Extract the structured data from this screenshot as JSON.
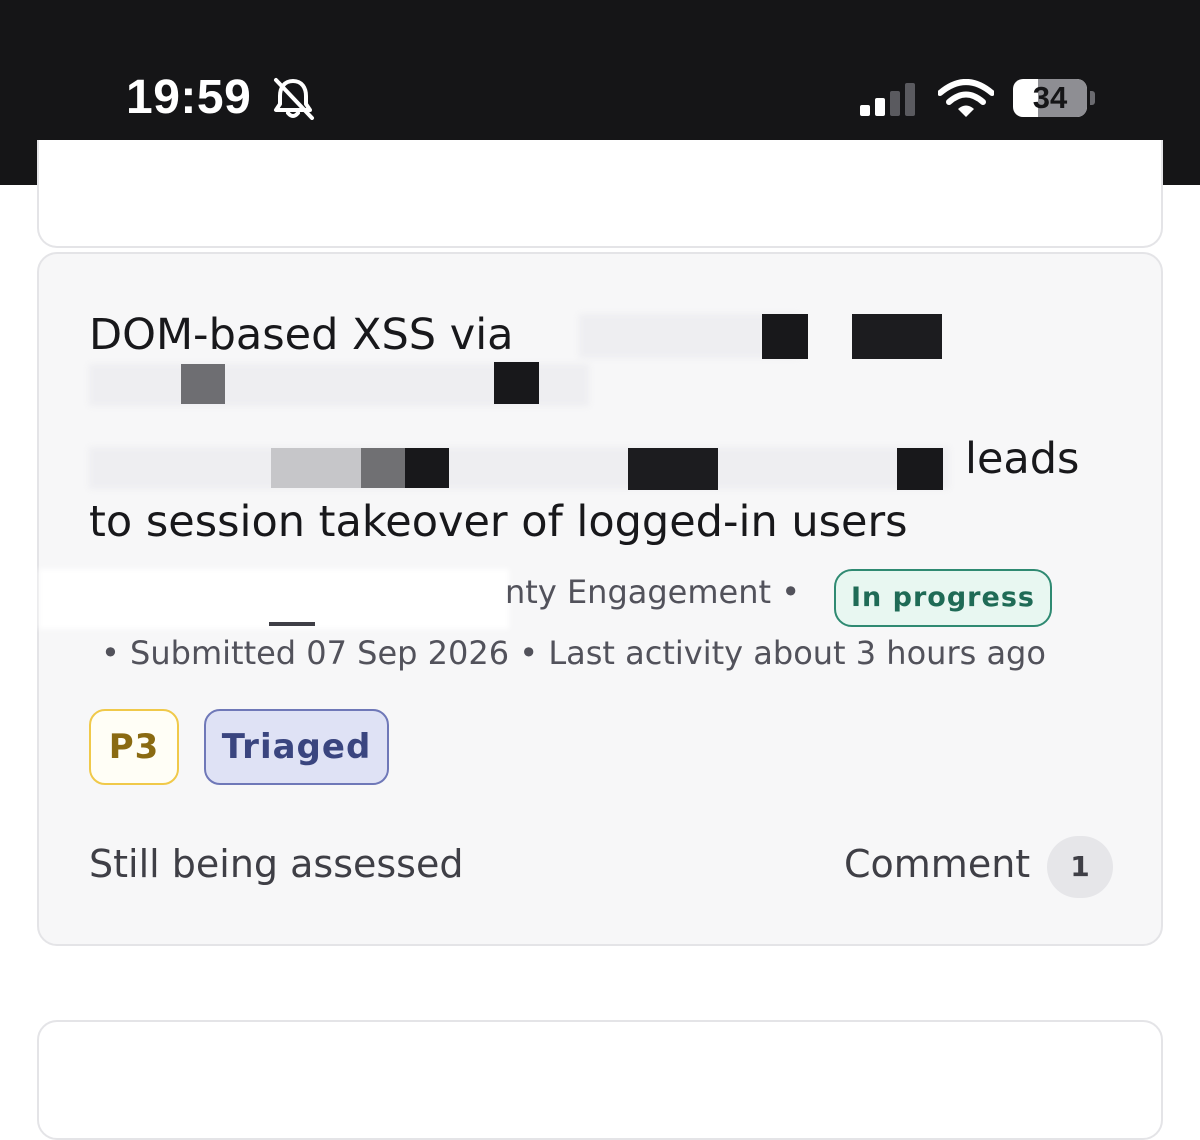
{
  "status_bar": {
    "time": "19:59",
    "battery_level": "34",
    "battery_fraction": 0.34,
    "icons": [
      "bell-slash-icon",
      "cellular-signal-icon",
      "wifi-icon",
      "battery-icon"
    ]
  },
  "report": {
    "title_start": "DOM-based XSS via",
    "title_leads": "leads",
    "title_end": "to session takeover of logged-in users",
    "program_suffix": "nty Engagement •",
    "status": "In progress",
    "submitted_line": "• Submitted 07 Sep 2026 • Last activity about 3 hours ago",
    "priority": "P3",
    "state": "Triaged",
    "assessment": "Still being assessed",
    "comment_label": "Comment",
    "comment_count": "1"
  },
  "colors": {
    "status_bar_bg": "#151517",
    "card_bg": "#f7f7f8",
    "in_progress": "#2f8a72",
    "priority_border": "#f0c94a",
    "triaged": "#6f78b8"
  }
}
